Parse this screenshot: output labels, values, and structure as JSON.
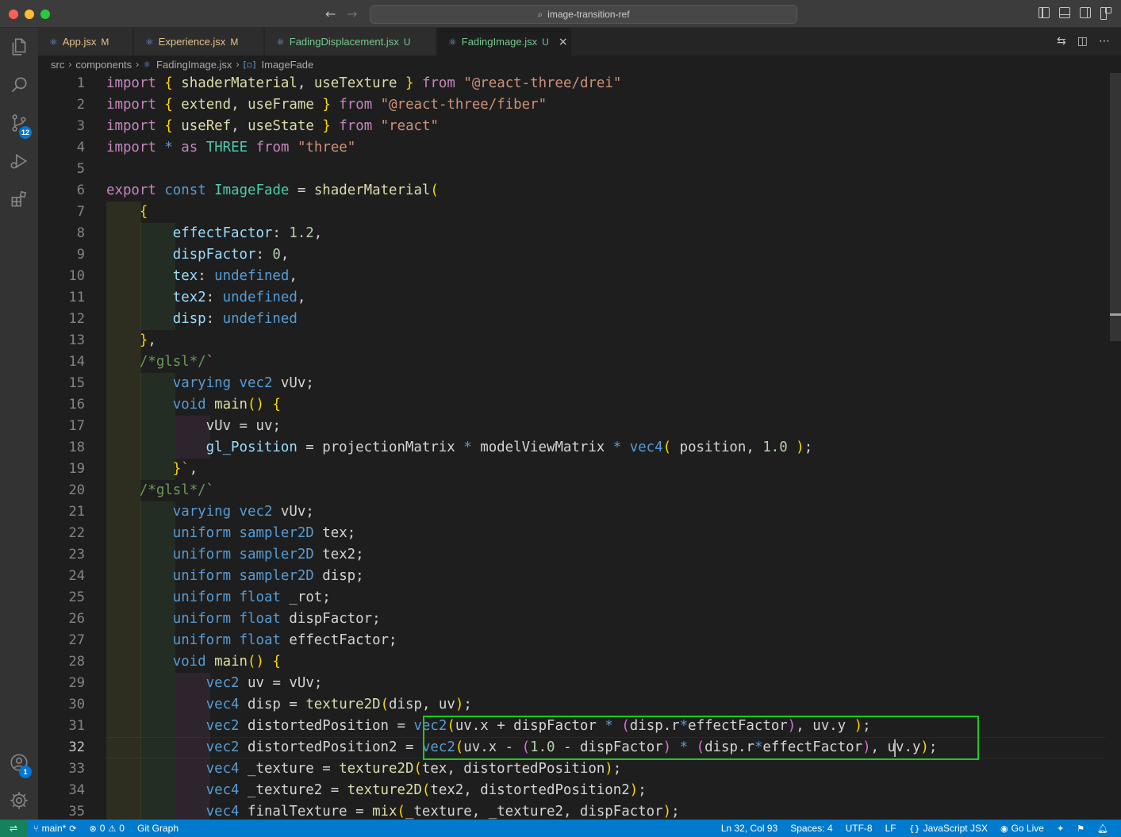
{
  "window": {
    "search_text": "image-transition-ref"
  },
  "activity": {
    "source_control_badge": "12",
    "accounts_badge": "1"
  },
  "tabs": [
    {
      "name": "App.jsx",
      "status": "M"
    },
    {
      "name": "Experience.jsx",
      "status": "M"
    },
    {
      "name": "FadingDisplacement.jsx",
      "status": "U"
    },
    {
      "name": "FadingImage.jsx",
      "status": "U"
    }
  ],
  "breadcrumb": {
    "parts": [
      "src",
      "components",
      "FadingImage.jsx",
      "ImageFade"
    ]
  },
  "editor": {
    "line_numbers": [
      "1",
      "2",
      "3",
      "4",
      "5",
      "6",
      "7",
      "8",
      "9",
      "10",
      "11",
      "12",
      "13",
      "14",
      "15",
      "16",
      "17",
      "18",
      "19",
      "20",
      "21",
      "22",
      "23",
      "24",
      "25",
      "26",
      "27",
      "28",
      "29",
      "30",
      "31",
      "32",
      "33",
      "34",
      "35"
    ],
    "current_line": 32,
    "lines": [
      "import { shaderMaterial, useTexture } from \"@react-three/drei\"",
      "import { extend, useFrame } from \"@react-three/fiber\"",
      "import { useRef, useState } from \"react\"",
      "import * as THREE from \"three\"",
      "",
      "export const ImageFade = shaderMaterial(",
      "    {",
      "        effectFactor: 1.2,",
      "        dispFactor: 0,",
      "        tex: undefined,",
      "        tex2: undefined,",
      "        disp: undefined",
      "    },",
      "    /*glsl*/`",
      "        varying vec2 vUv;",
      "        void main() {",
      "            vUv = uv;",
      "            gl_Position = projectionMatrix * modelViewMatrix * vec4( position, 1.0 );",
      "        }`,",
      "    /*glsl*/`",
      "        varying vec2 vUv;",
      "        uniform sampler2D tex;",
      "        uniform sampler2D tex2;",
      "        uniform sampler2D disp;",
      "        uniform float _rot;",
      "        uniform float dispFactor;",
      "        uniform float effectFactor;",
      "        void main() {",
      "            vec2 uv = vUv;",
      "            vec4 disp = texture2D(disp, uv);",
      "            vec2 distortedPosition = vec2(uv.x + dispFactor * (disp.r*effectFactor), uv.y );",
      "            vec2 distortedPosition2 = vec2(uv.x - (1.0 - dispFactor) * (disp.r*effectFactor), uv.y);",
      "            vec4 _texture = texture2D(tex, distortedPosition);",
      "            vec4 _texture2 = texture2D(tex2, distortedPosition2);",
      "            vec4 finalTexture = mix(_texture, _texture2, dispFactor);"
    ]
  },
  "status": {
    "branch": "main*",
    "errors": "0",
    "warnings": "0",
    "git_graph": "Git Graph",
    "position": "Ln 32, Col 93",
    "spaces": "Spaces: 4",
    "encoding": "UTF-8",
    "eol": "LF",
    "language": "JavaScript JSX",
    "go_live": "Go Live"
  },
  "icons": [
    "explorer-icon",
    "search-icon",
    "source-control-icon",
    "run-debug-icon",
    "extensions-icon",
    "accounts-icon",
    "manage-gear-icon",
    "react-file-icon",
    "close-icon",
    "split-editor-icon",
    "more-actions-icon",
    "branch-icon",
    "sync-icon",
    "error-icon",
    "warning-icon",
    "bell-icon",
    "remote-icon"
  ],
  "colors": {
    "accent": "#007acc",
    "highlight_box": "#22c522",
    "modified": "#e2c08d",
    "untracked": "#73c991"
  }
}
